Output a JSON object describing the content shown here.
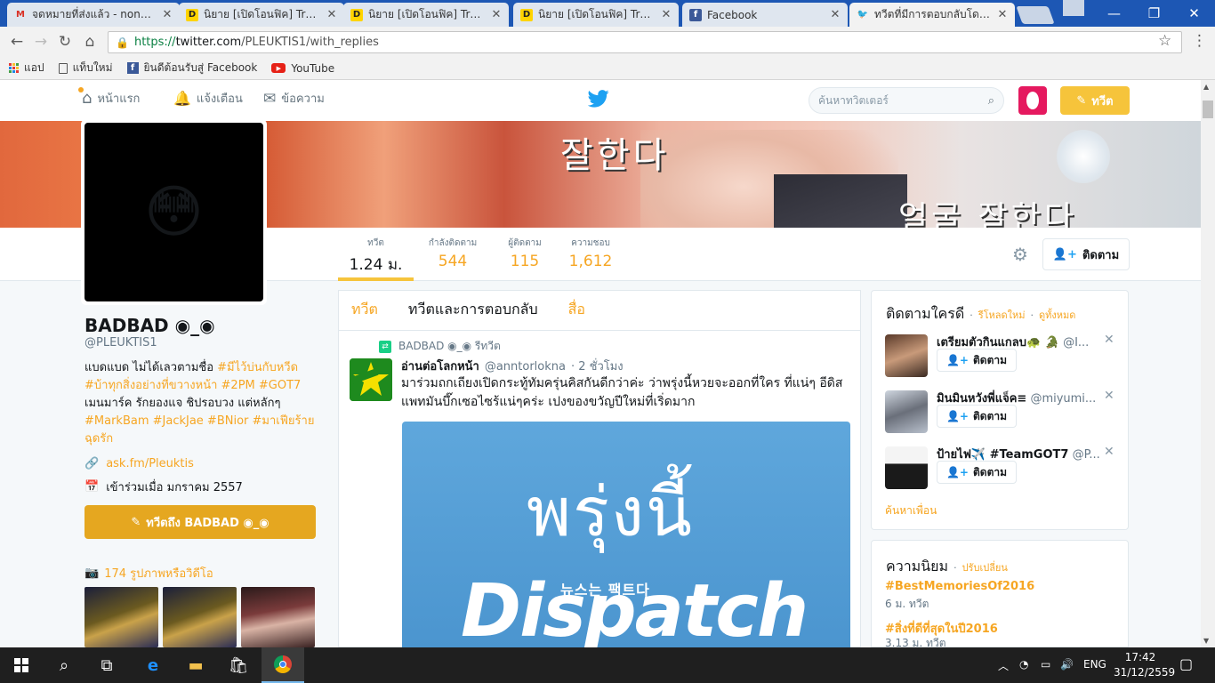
{
  "browser": {
    "tabs": [
      {
        "label": "จดหมายที่ส่งแล้ว - nong.m",
        "icon": "gmail-icon",
        "active": false
      },
      {
        "label": "นิยาย [เปิดโอนฟิค] Traction",
        "icon": "dek-d-icon",
        "active": false
      },
      {
        "label": "นิยาย [เปิดโอนฟิค] Traction",
        "icon": "dek-d-icon",
        "active": false
      },
      {
        "label": "นิยาย [เปิดโอนฟิค] Traction",
        "icon": "dek-d-icon",
        "active": false
      },
      {
        "label": "Facebook",
        "icon": "facebook-icon",
        "active": false
      },
      {
        "label": "ทวีตที่มีการตอบกลับโดย BA",
        "icon": "twitter-icon",
        "active": true
      }
    ],
    "url_secure": "https://",
    "url_host": "twitter.com",
    "url_path": "/PLEUKTIS1/with_replies",
    "bookmarks": [
      {
        "label": "แอป",
        "icon": "apps-grid-icon"
      },
      {
        "label": "แท็บใหม่",
        "icon": "page-icon"
      },
      {
        "label": "ยินดีต้อนรับสู่ Facebook",
        "icon": "facebook-icon"
      },
      {
        "label": "YouTube",
        "icon": "youtube-icon"
      }
    ]
  },
  "topnav": {
    "home": "หน้าแรก",
    "notifications": "แจ้งเตือน",
    "messages": "ข้อความ",
    "search_placeholder": "ค้นหาทวิตเตอร์",
    "tweet_button": "ทวีต"
  },
  "banner": {
    "text1": "잘한다",
    "text2": "얼굴 잘한다"
  },
  "stats": [
    {
      "label": "ทวีต",
      "value": "1.24 ม."
    },
    {
      "label": "กำลังติดตาม",
      "value": "544"
    },
    {
      "label": "ผู้ติดตาม",
      "value": "115"
    },
    {
      "label": "ความชอบ",
      "value": "1,612"
    }
  ],
  "follow_button": "ติดตาม",
  "profile": {
    "avatar_emoji": "😳",
    "name": "BADBAD ◉_◉",
    "handle": "@PLEUKTIS1",
    "bio_lines": [
      {
        "plain": "แบดแบด ไม่ได้เลวตามชื่อ ",
        "tag": "#มีไว้บ่นกับหวีด"
      },
      {
        "plain": "",
        "tag": "#บ้าทุกสิ่งอย่างที่ขวางหน้า #2PM #GOT7"
      },
      {
        "plain": "เมนมาร์ค รักยองแจ ชิปรอบวง แต่หลักๆ",
        "tag": ""
      },
      {
        "plain": "",
        "tag": "#MarkBam #JackJae #BNior #มาเฟียร้าย"
      },
      {
        "plain": "",
        "tag": "ฉุดรัก"
      }
    ],
    "link": "ask.fm/Pleuktis",
    "joined": "เข้าร่วมเมื่อ มกราคม 2557",
    "tweet_to": "ทวีตถึง BADBAD ◉_◉",
    "photos": "174 รูปภาพหรือวิดีโอ"
  },
  "timeline": {
    "tabs": [
      "ทวีต",
      "ทวีตและการตอบกลับ",
      "สื่อ"
    ],
    "retweet_by": "BADBAD ◉_◉ รีทวีต",
    "tweet": {
      "name": "อ่านต่อโลกหน้า",
      "handle": "@anntorlokna",
      "time": "· 2 ชั่วโมง",
      "text": "มาร่วมถกเถียงเปิดกระทู้ทัมครุ่นคิสกันดีกว่าค่ะ ว่าพรุ่งนี้หวยจะออกที่ใคร ที่แน่ๆ อีดิสแพทมันบึ๊กเซอไซร้แน่ๆคร่ะ เปงของขวัญปีใหม่ที่เริ่ดมาก",
      "image_text_thai": "พรุ่งนี้",
      "image_text_korean": "뉴스는 팩트다",
      "image_text_brand": "Dispatch",
      "image_text_reg": "©"
    }
  },
  "who_to_follow": {
    "title": "ติดตามใครดี",
    "refresh": "รีโหลดใหม่",
    "view_all": "ดูทั้งหมด",
    "users": [
      {
        "name": "เตรียมตัวกินแกลบ🐢 🐊",
        "handle": "@I...",
        "button": "ติดตาม"
      },
      {
        "name": "มินมินหวังพี่แจ็ค≡",
        "handle": "@miyumi...",
        "button": "ติดตาม"
      },
      {
        "name": "ป้ายไฟ✈️ #TeamGOT7",
        "handle": "@P...",
        "button": "ติดตาม"
      }
    ],
    "find_friends": "ค้นหาเพื่อน"
  },
  "trends": {
    "title": "ความนิยม",
    "change": "ปรับเปลี่ยน",
    "items": [
      {
        "name": "#BestMemoriesOf2016",
        "count": "6 ม. ทวีต"
      },
      {
        "name": "#สิ่งที่ดีที่สุดในปี2016",
        "count": "3.13 ม. ทวีต"
      }
    ]
  },
  "taskbar": {
    "lang": "ENG",
    "time": "17:42",
    "date": "31/12/2559"
  },
  "colors": {
    "accent": "#f6a623",
    "tweet_button": "#f6c43b",
    "twitter_blue": "#1da1f2",
    "tab_strip": "#1d57b4"
  }
}
